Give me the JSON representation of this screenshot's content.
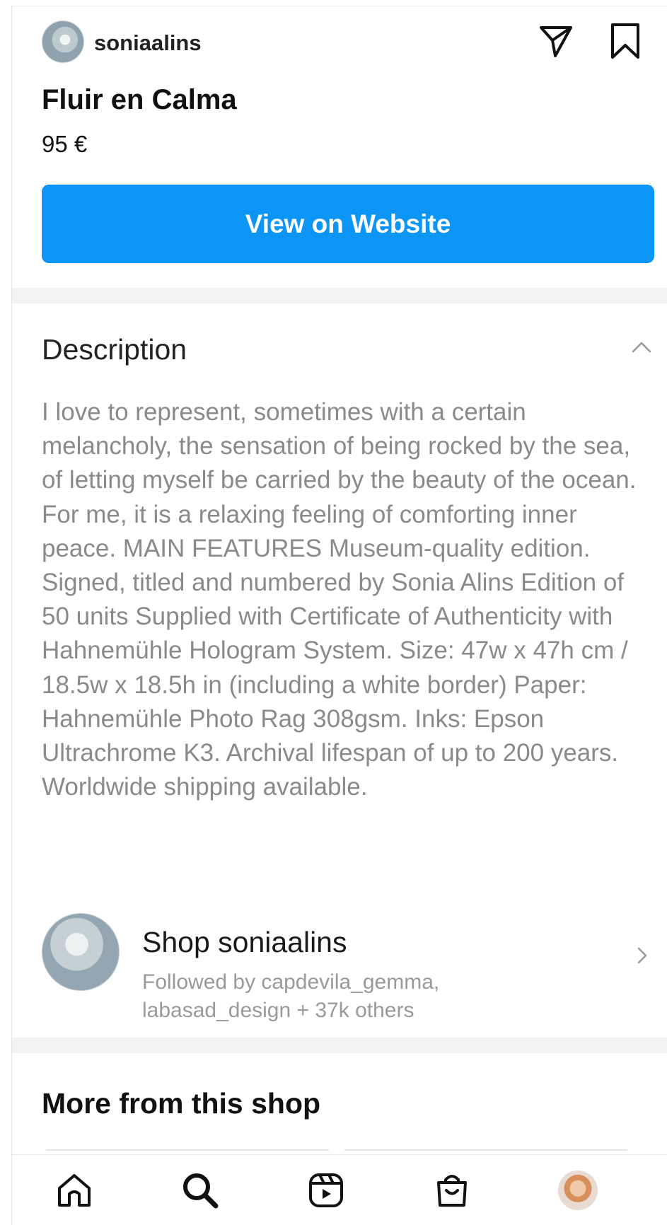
{
  "header": {
    "username": "soniaalins"
  },
  "product": {
    "title": "Fluir en Calma",
    "price": "95 €",
    "cta_label": "View on Website"
  },
  "description": {
    "heading": "Description",
    "body": "I love to represent, sometimes with a certain melancholy, the sensation of being rocked by the sea, of letting myself be carried by the beauty of the ocean. For me, it is a relaxing feeling of comforting inner peace. MAIN FEATURES Museum-quality edition. Signed, titled and numbered by Sonia Alins Edition of 50 units Supplied with Certificate of Authenticity with Hahnemühle Hologram System. Size: 47w x 47h cm / 18.5w x 18.5h in (including a white border) Paper: Hahnemühle Photo Rag 308gsm. Inks: Epson Ultrachrome K3. Archival lifespan of up to 200 years. Worldwide shipping available."
  },
  "shop": {
    "name": "Shop soniaalins",
    "followers": "Followed by capdevila_gemma, labasad_design + 37k others"
  },
  "more_from_shop": {
    "heading": "More from this shop"
  },
  "icons": {
    "share": "paper-plane-icon",
    "save": "bookmark-icon",
    "collapse": "chevron-up-icon",
    "shop_open": "chevron-right-icon",
    "nav": [
      "home-icon",
      "search-icon",
      "reels-icon",
      "shop-bag-icon",
      "profile-avatar"
    ]
  },
  "colors": {
    "accent": "#0d95f6",
    "muted_text": "#8a8a8a",
    "divider": "#f3f3f3"
  }
}
